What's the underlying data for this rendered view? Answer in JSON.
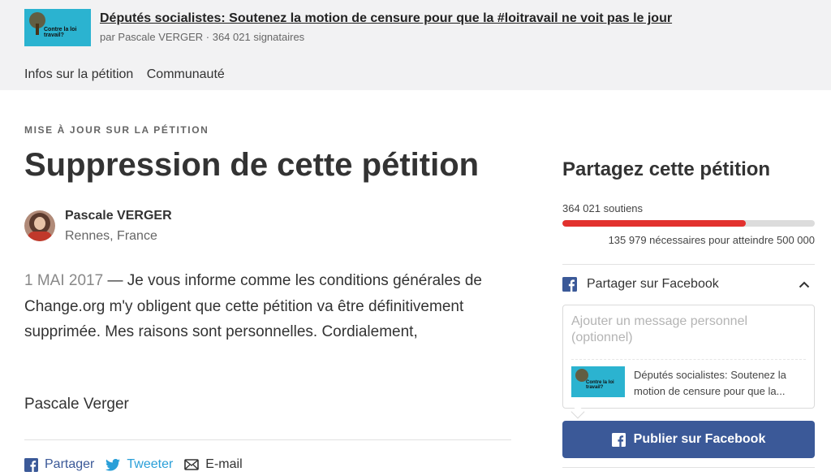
{
  "header": {
    "petition_title": "Députés socialistes: Soutenez la motion de censure pour que la #loitravail ne voit pas le jour",
    "petition_subtitle": "par Pascale VERGER · 364 021 signataires",
    "thumbnail_text": "Contre la loi travail?",
    "nav": [
      "Infos sur la pétition",
      "Communauté"
    ]
  },
  "update": {
    "kicker": "MISE À JOUR SUR LA PÉTITION",
    "title": "Suppression de cette pétition",
    "author_name": "Pascale VERGER",
    "author_location": "Rennes, France",
    "date": "1 MAI 2017",
    "body": " — Je vous informe comme les conditions générales de Change.org m'y obligent que cette pétition va être définitivement supprimée. Mes raisons sont personnelles. Cordialement,",
    "signature": "Pascale Verger"
  },
  "share_links": {
    "facebook": "Partager",
    "twitter": "Tweeter",
    "email": "E-mail"
  },
  "sidebar": {
    "heading": "Partagez cette pétition",
    "supporters": "364 021 soutiens",
    "progress_fraction": 0.728,
    "needed": "135 979 nécessaires pour atteindre 500 000",
    "facebook_section": "Partager sur Facebook",
    "message_placeholder": "Ajouter un message personnel (optionnel)",
    "preview_text": "Députés socialistes: Soutenez la motion de censure pour que la...",
    "publish_button": "Publier sur Facebook"
  },
  "colors": {
    "progress": "#e2312e",
    "facebook": "#3b5998",
    "twitter": "#2a9fd8"
  }
}
